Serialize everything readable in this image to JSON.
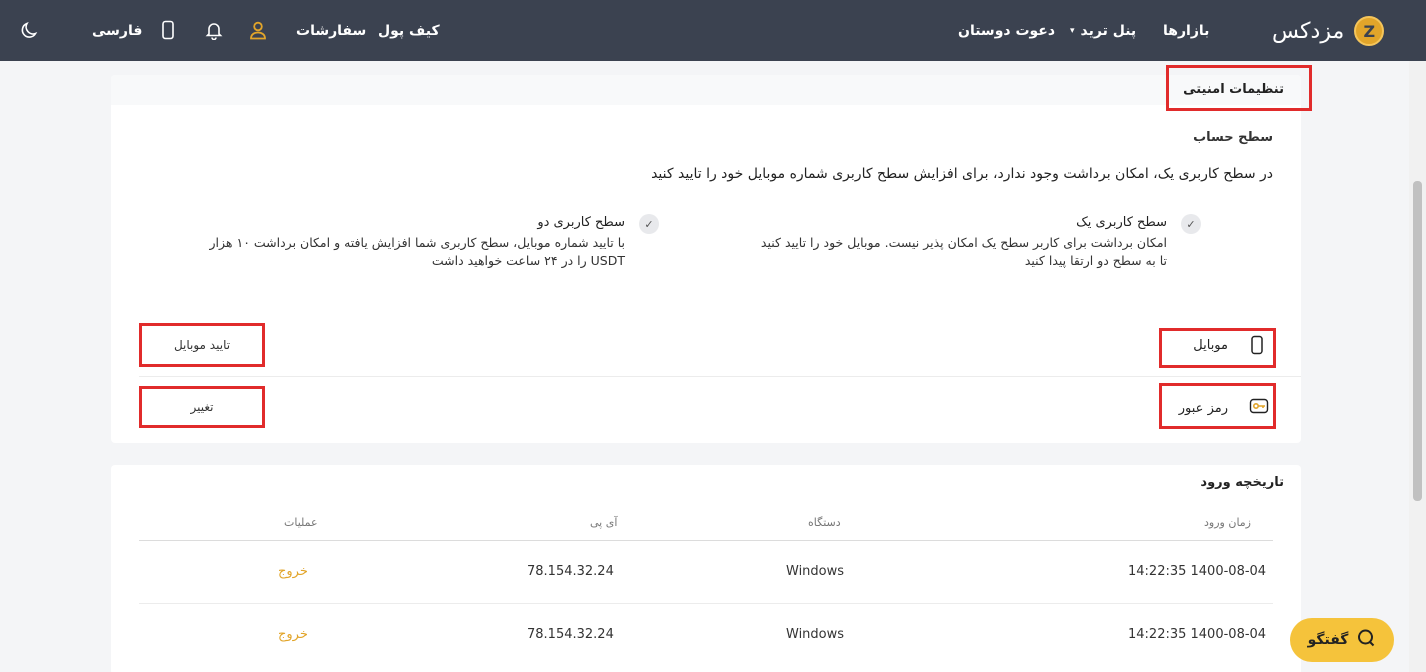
{
  "nav": {
    "brand": "مزدکس",
    "brand_glyph": "Z",
    "markets": "بازارها",
    "trade_panel": "پنل ترید",
    "invite": "دعوت دوستان",
    "wallet": "کیف پول",
    "orders": "سفارشات",
    "language": "فارسی",
    "caret": "▾",
    "icons": [
      "user-icon",
      "bell-icon",
      "mobile-icon",
      "moon-icon"
    ],
    "accent_color": "#e2a52a"
  },
  "security": {
    "title": "تنظیمات امنیتی",
    "account_level_title": "سطح حساب",
    "info": "در سطح کاربری یک، امکان برداشت وجود ندارد، برای افزایش سطح کاربری شماره موبایل خود را تایید کنید",
    "levels": [
      {
        "title": "سطح کاربری یک",
        "lines": [
          "امکان برداشت برای کاربر سطح یک امکان پذیر نیست. موبایل خود را تایید کنید",
          "تا به سطح دو ارتقا پیدا کنید"
        ]
      },
      {
        "title": "سطح کاربری دو",
        "lines": [
          "با تایید شماره موبایل، سطح کاربری شما افزایش یافته و امکان برداشت ۱۰ هزار",
          "USDT را در ۲۴ ساعت خواهید داشت"
        ]
      }
    ],
    "check_glyph": "✓",
    "mobile": {
      "label": "موبایل",
      "button": "تایید موبایل"
    },
    "password": {
      "label": "رمز عبور",
      "button": "تغییر"
    }
  },
  "history": {
    "title": "تاریخچه ورود",
    "columns": [
      "زمان ورود",
      "دستگاه",
      "آی پی",
      "عملیات"
    ],
    "rows": [
      {
        "time": "14:22:35 1400-08-04",
        "device": "Windows",
        "ip": "78.154.32.24",
        "action": "خروج"
      },
      {
        "time": "14:22:35 1400-08-04",
        "device": "Windows",
        "ip": "78.154.32.24",
        "action": "خروج"
      }
    ]
  },
  "chat": {
    "label": "گفتگو"
  }
}
